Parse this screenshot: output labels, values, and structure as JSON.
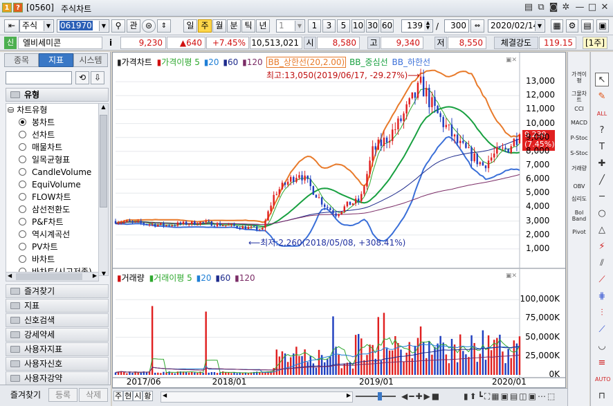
{
  "window": {
    "code": "[0560]",
    "title": "주식차트"
  },
  "toolbar": {
    "market": "주식",
    "ticker": "061970",
    "btn_gwan": "관",
    "periods": [
      "일",
      "주",
      "월",
      "분",
      "틱",
      "년"
    ],
    "active_period": "주",
    "interval_value": "1",
    "quick_intervals": [
      "1",
      "3",
      "5",
      "10",
      "30",
      "60"
    ],
    "count_value": "139",
    "slash": "/",
    "total_value": "300",
    "date_value": "2020/02/14"
  },
  "quote": {
    "tag": "신",
    "name": "엘비세미콘",
    "info": "i",
    "price": "9,230",
    "change": "▲640",
    "change_pct": "+7.45%",
    "volume": "10,513,021",
    "open_label": "시",
    "open": "8,580",
    "high_label": "고",
    "high": "9,340",
    "low_label": "저",
    "low": "8,550",
    "strength_label": "체결강도",
    "strength": "119.15",
    "period_tag": "[1주]"
  },
  "left_panel": {
    "tabs": [
      "종목",
      "지표",
      "시스템"
    ],
    "selected_tab": "지표",
    "section_title": "유형",
    "group_title": "차트유형",
    "chart_types": [
      "봉차트",
      "선차트",
      "매물차트",
      "일목균형표",
      "CandleVolume",
      "EquiVolume",
      "FLOW차트",
      "삼선전환도",
      "P&F차트",
      "역시계곡선",
      "PV차트",
      "바차트",
      "바차트(시고저종)"
    ],
    "selected_type": "봉차트",
    "categories": [
      "즐겨찾기",
      "지표",
      "신호검색",
      "강세약세",
      "사용자지표",
      "사용자신호",
      "사용자강약"
    ],
    "bottom_tabs": [
      "즐겨찾기",
      "등록",
      "삭제"
    ]
  },
  "price_panel": {
    "legend_title": "가격차트",
    "legend_ma_label": "가격이평",
    "ma_periods": [
      "5",
      "20",
      "60",
      "120"
    ],
    "bb_upper": "BB_상한선(20,2.00)",
    "bb_mid": "BB_중심선",
    "bb_lower": "BB_하한선",
    "high_note": "최고:13,050(2019/06/17, -29.27%)⟶",
    "low_note": "⟵최저:2,260(2018/05/08, +308.41%)",
    "current_price_tag": "9,230",
    "current_pct_tag": "(7.45%)",
    "y_ticks": [
      "13,000",
      "12,000",
      "11,000",
      "10,000",
      "9,000",
      "8,000",
      "7,000",
      "6,000",
      "5,000",
      "4,000",
      "3,000",
      "2,000",
      "1,000"
    ]
  },
  "volume_panel": {
    "legend_title": "거래량",
    "legend_ma_label": "거래이평",
    "ma_periods": [
      "5",
      "20",
      "60",
      "120"
    ],
    "y_ticks": [
      "100,000K",
      "75,000K",
      "50,000K",
      "25,000K",
      "0K"
    ]
  },
  "x_axis": {
    "labels": [
      "2017/06",
      "2018/01",
      "2019/01",
      "2020/01"
    ]
  },
  "bottom_bar": {
    "buttons": [
      "주",
      "현",
      "시",
      "황"
    ]
  },
  "right_tools": {
    "indicators": [
      "가격이평",
      "그물차트",
      "CCI",
      "MACD",
      "P-Stoc",
      "S-Stoc",
      "거래량",
      "OBV",
      "심리도",
      "Bol Band",
      "Pivot"
    ]
  },
  "colors": {
    "up": "#e02020",
    "down": "#1f3fbf",
    "ma5": "#2ea82e",
    "ma20": "#1f7fd6",
    "ma60": "#1d2a8c",
    "ma120": "#7b2c66",
    "bb_upper": "#e87a2a",
    "bb_mid": "#18a040",
    "bb_lower": "#3a6fd8"
  },
  "chart_data": {
    "type": "candlestick",
    "x_start": "2017/05",
    "x_end": "2020/02",
    "ylim": [
      0,
      14000
    ],
    "volume_ylim": [
      0,
      125000
    ],
    "weekly_close_anchors": [
      {
        "date": "2017/05",
        "value": 3000
      },
      {
        "date": "2017/09",
        "value": 2700
      },
      {
        "date": "2017/12",
        "value": 2900
      },
      {
        "date": "2018/05",
        "value": 2400
      },
      {
        "date": "2018/06",
        "value": 5000
      },
      {
        "date": "2018/08",
        "value": 6500
      },
      {
        "date": "2018/10",
        "value": 4200
      },
      {
        "date": "2018/11",
        "value": 3500
      },
      {
        "date": "2018/12",
        "value": 4200
      },
      {
        "date": "2019/01",
        "value": 4500
      },
      {
        "date": "2019/02",
        "value": 8000
      },
      {
        "date": "2019/03",
        "value": 8800
      },
      {
        "date": "2019/04",
        "value": 9800
      },
      {
        "date": "2019/06",
        "value": 12800
      },
      {
        "date": "2019/07",
        "value": 11000
      },
      {
        "date": "2019/09",
        "value": 8500
      },
      {
        "date": "2019/11",
        "value": 7000
      },
      {
        "date": "2019/12",
        "value": 7800
      },
      {
        "date": "2020/01",
        "value": 8200
      },
      {
        "date": "2020/02",
        "value": 9230
      }
    ],
    "extremes": {
      "high": {
        "date": "2019/06/17",
        "value": 13050
      },
      "low": {
        "date": "2018/05/08",
        "value": 2260
      }
    }
  }
}
